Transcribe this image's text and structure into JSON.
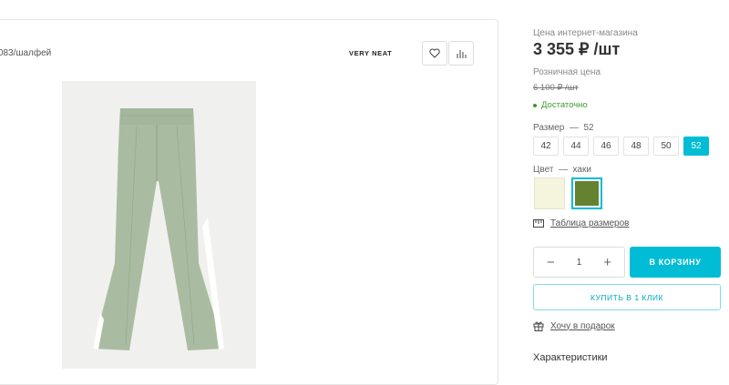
{
  "product": {
    "sku_color": "083/шалфей",
    "brand": "VERY NEAT",
    "favorite_icon": "heart-icon",
    "compare_icon": "bar-chart-icon"
  },
  "pricing": {
    "online_label": "Цена интернет-магазина",
    "online_price": "3 355 ₽ /шт",
    "retail_label": "Розничная цена",
    "retail_price": "6 100 ₽ /шт",
    "stock": "Достаточно"
  },
  "size": {
    "label": "Размер",
    "selected": "52",
    "options": [
      "42",
      "44",
      "46",
      "48",
      "50",
      "52"
    ]
  },
  "color": {
    "label": "Цвет",
    "selected": "хаки",
    "swatches": [
      "#f5f4dc",
      "#658230"
    ]
  },
  "size_table": "Таблица размеров",
  "cart": {
    "quantity": "1",
    "minus": "−",
    "plus": "+",
    "add_button": "В КОРЗИНУ",
    "one_click": "КУПИТЬ В 1 КЛИК"
  },
  "gift": "Хочу в подарок",
  "characteristics": "Характеристики",
  "colors": {
    "accent": "#00bcd4",
    "stock_green": "#3c9a2f",
    "pants": "#a9bca1"
  }
}
